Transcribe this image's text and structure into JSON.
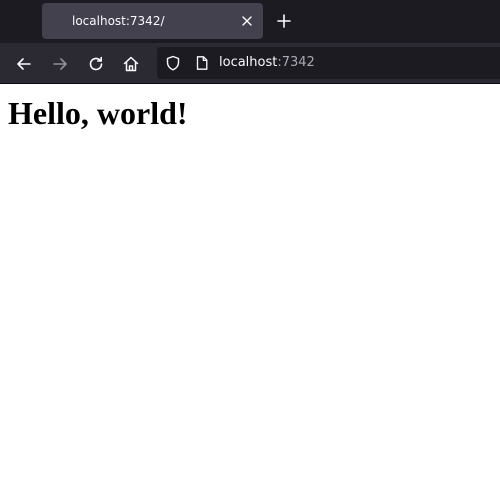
{
  "tabs": [
    {
      "title": "localhost:7342/",
      "active": true
    }
  ],
  "addressbar": {
    "host": "localhost",
    "port": ":7342"
  },
  "icons": {
    "back": "arrow-left-icon",
    "forward": "arrow-right-icon",
    "reload": "reload-icon",
    "home": "home-icon",
    "tracking_protection": "shield-icon",
    "page": "page-icon",
    "tab_close": "close-icon",
    "new_tab": "plus-icon"
  },
  "colors": {
    "tabstrip_bg": "#1c1b22",
    "active_tab_bg": "#42414d",
    "toolbar_bg": "#2b2a33",
    "urlbar_bg": "#1c1b22",
    "page_bg": "#ffffff"
  },
  "page": {
    "heading": "Hello, world!"
  }
}
